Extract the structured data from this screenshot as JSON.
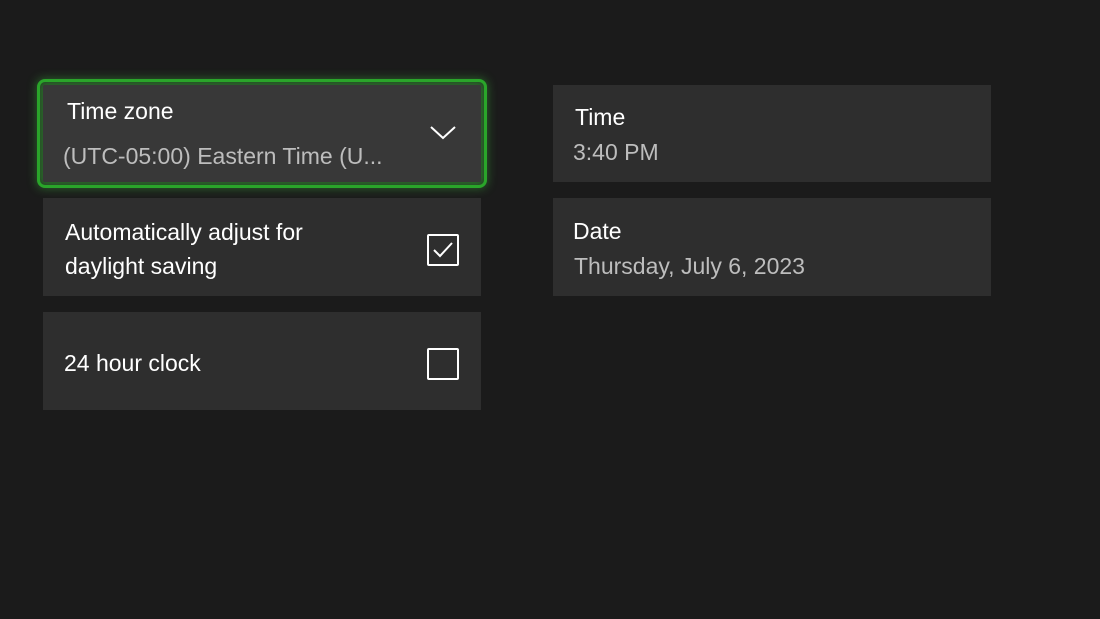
{
  "timezone": {
    "label": "Time zone",
    "value": "(UTC-05:00) Eastern Time (U...",
    "icon": "chevron-down-icon"
  },
  "daylight_saving": {
    "label": "Automatically adjust for daylight saving",
    "checked": true,
    "icon": "checkmark-icon"
  },
  "clock_24h": {
    "label": "24 hour clock",
    "checked": false
  },
  "time": {
    "label": "Time",
    "value": "3:40 PM"
  },
  "date": {
    "label": "Date",
    "value": "Thursday, July 6, 2023"
  },
  "colors": {
    "background": "#1b1b1b",
    "tile": "#2e2e2e",
    "focus": "#2aa52a",
    "secondary_text": "#bdbdbd"
  }
}
